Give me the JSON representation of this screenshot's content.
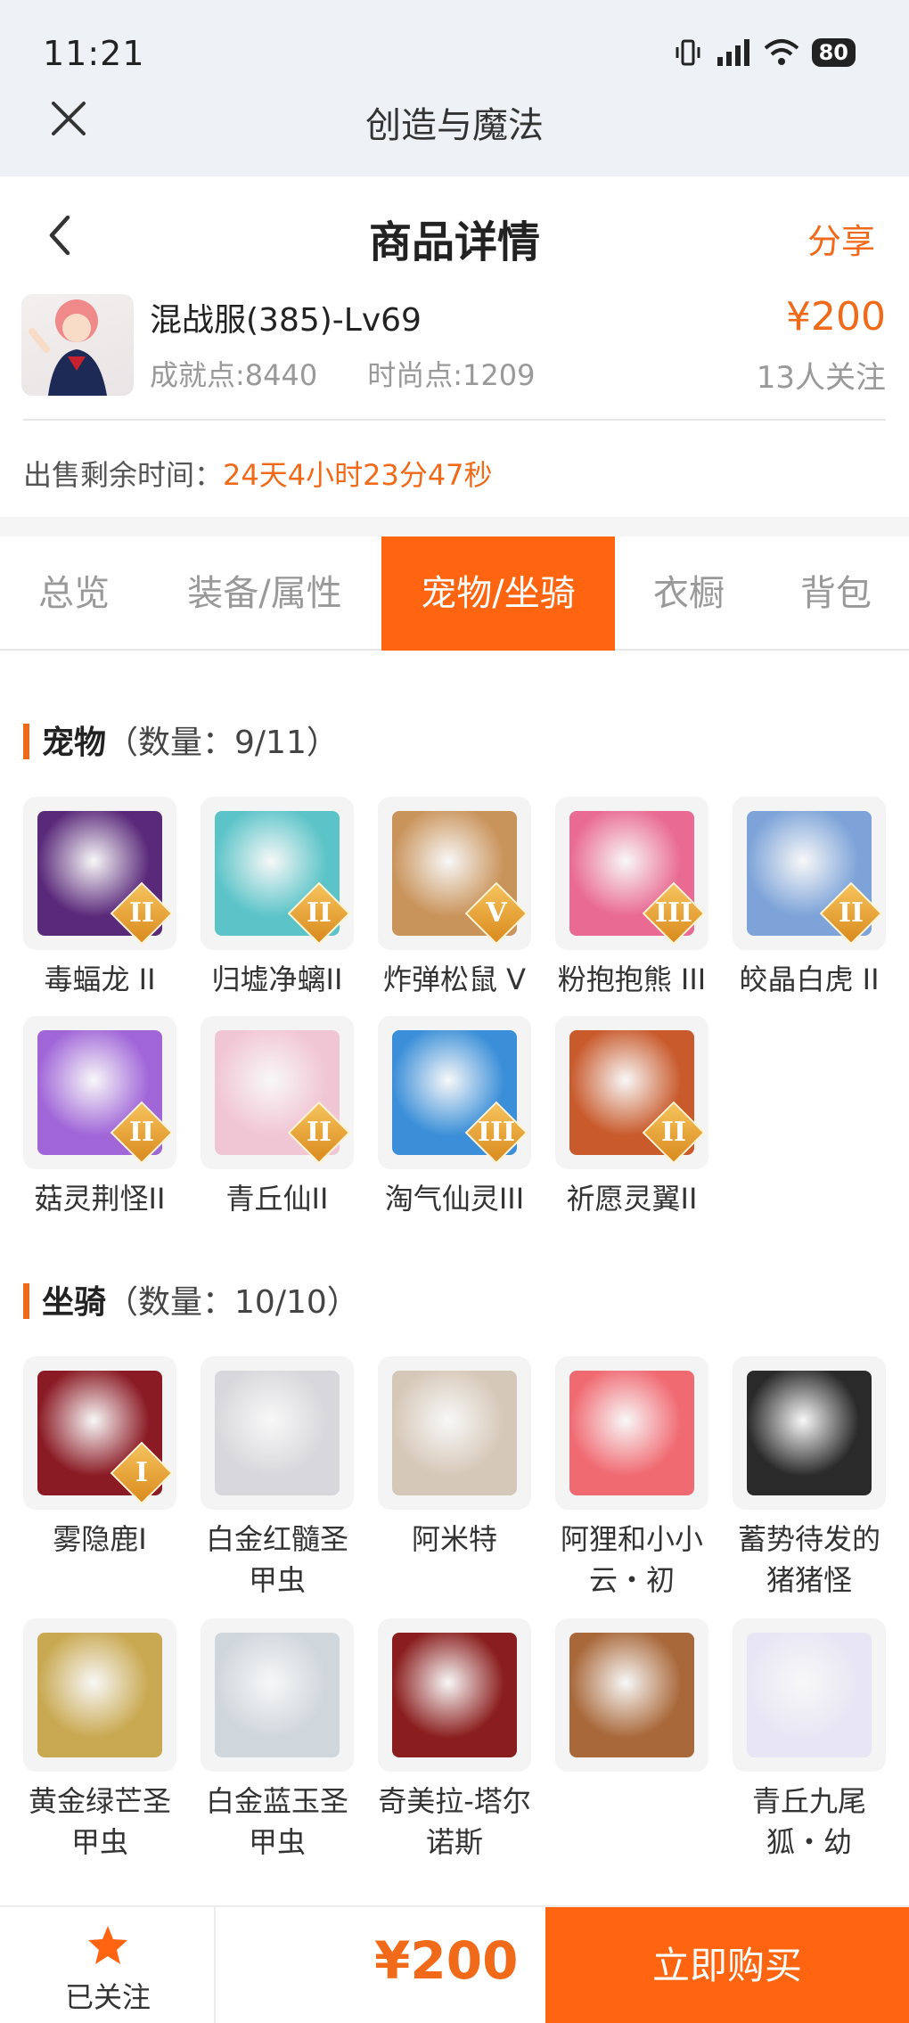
{
  "status": {
    "time": "11:21",
    "battery": "80"
  },
  "app": {
    "title": "创造与魔法"
  },
  "header": {
    "title": "商品详情",
    "share": "分享"
  },
  "item": {
    "name": "混战服(385)-Lv69",
    "achievement": "成就点:8440",
    "fashion": "时尚点:1209",
    "price": "¥200",
    "followers": "13人关注"
  },
  "sale": {
    "label": "出售剩余时间：",
    "value": "24天4小时23分47秒"
  },
  "tabs": [
    "总览",
    "装备/属性",
    "宠物/坐骑",
    "衣橱",
    "背包"
  ],
  "pets": {
    "title": "宠物",
    "count": "（数量：9/11）",
    "items": [
      {
        "name": "毒蝠龙 II",
        "grade": "II",
        "color": "#5a2a7a"
      },
      {
        "name": "归墟净螭II",
        "grade": "II",
        "color": "#5cc4c8"
      },
      {
        "name": "炸弹松鼠 V",
        "grade": "V",
        "color": "#c9945c"
      },
      {
        "name": "粉抱抱熊 III",
        "grade": "III",
        "color": "#e96a92"
      },
      {
        "name": "皎晶白虎 II",
        "grade": "II",
        "color": "#7da3d8"
      },
      {
        "name": "菇灵荆怪II",
        "grade": "II",
        "color": "#a066d8"
      },
      {
        "name": "青丘仙II",
        "grade": "II",
        "color": "#f1c6d4"
      },
      {
        "name": "淘气仙灵III",
        "grade": "III",
        "color": "#3b8fd8"
      },
      {
        "name": "祈愿灵翼II",
        "grade": "II",
        "color": "#c85a2c"
      }
    ]
  },
  "mounts": {
    "title": "坐骑",
    "count": "（数量：10/10）",
    "items": [
      {
        "name": "雾隐鹿I",
        "grade": "I",
        "color": "#8a1a24"
      },
      {
        "name": "白金红髓圣甲虫",
        "grade": "",
        "color": "#d8d8dc"
      },
      {
        "name": "阿米特",
        "grade": "",
        "color": "#d6c8b8"
      },
      {
        "name": "阿狸和小小云・初",
        "grade": "",
        "color": "#f06a72"
      },
      {
        "name": "蓄势待发的猪猪怪",
        "grade": "",
        "color": "#2a2a2a"
      },
      {
        "name": "黄金绿芒圣甲虫",
        "grade": "",
        "color": "#c8a850"
      },
      {
        "name": "白金蓝玉圣甲虫",
        "grade": "",
        "color": "#cfd6dc"
      },
      {
        "name": "奇美拉-塔尔诺斯",
        "grade": "",
        "color": "#8a1e1e"
      },
      {
        "name": "",
        "grade": "",
        "color": "#a8683a"
      },
      {
        "name": "青丘九尾狐・幼",
        "grade": "",
        "color": "#e8e6f4"
      }
    ]
  },
  "footer": {
    "follow_label": "已关注",
    "price": "¥200",
    "buy_label": "立即购买"
  },
  "colors": {
    "accent": "#ff6410",
    "price": "#f06a1a"
  }
}
